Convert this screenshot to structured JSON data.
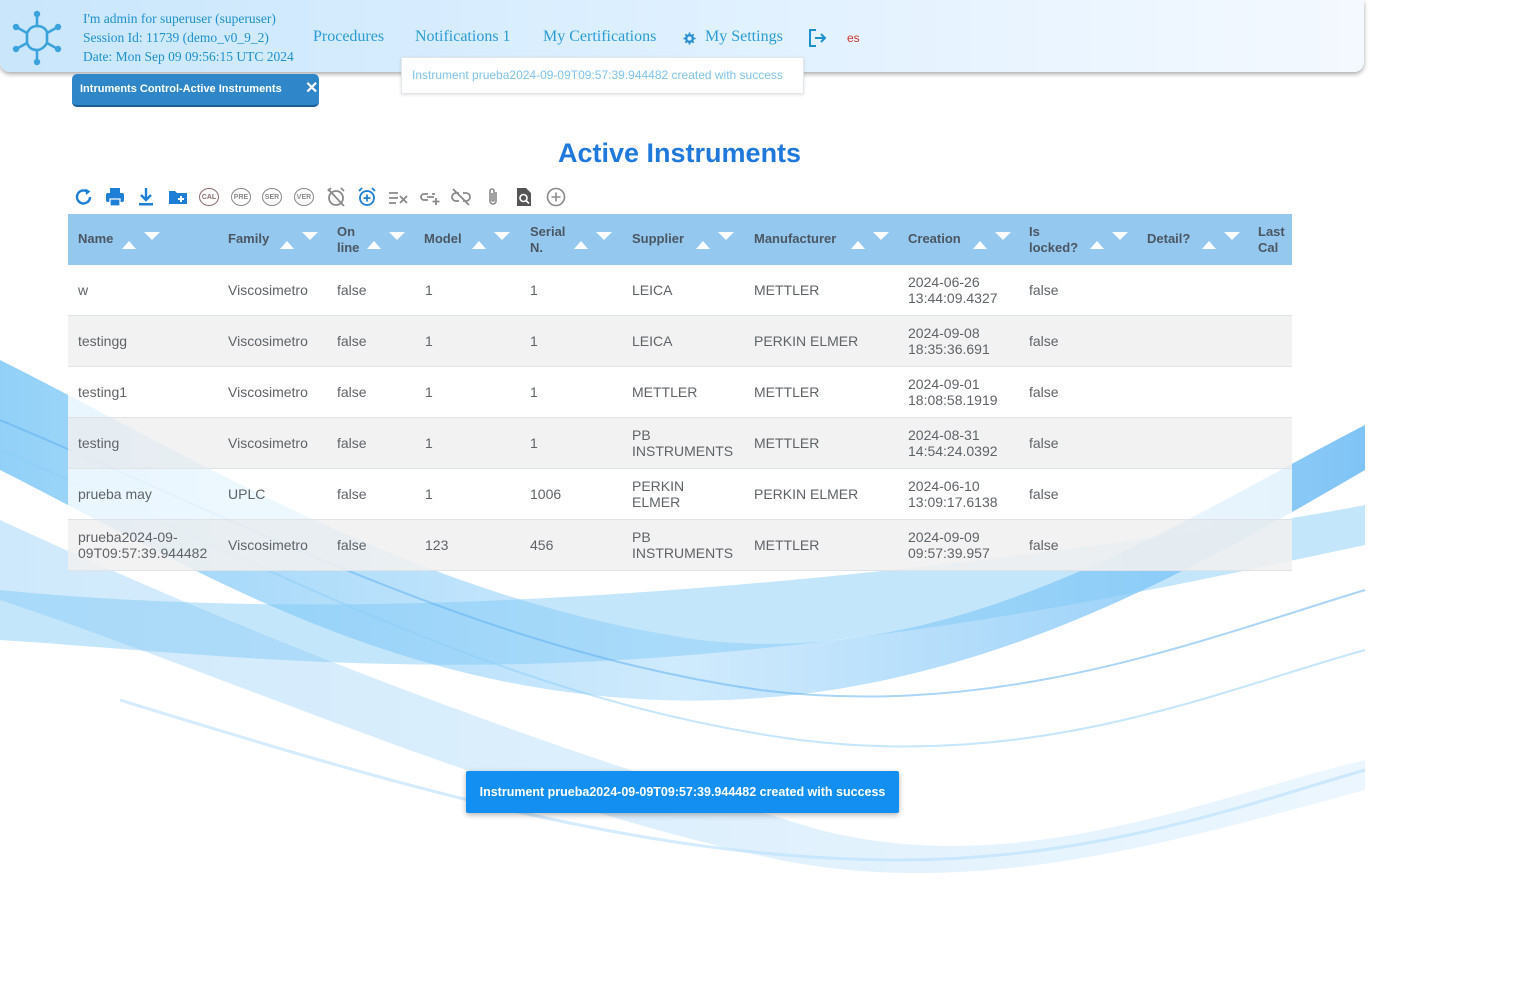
{
  "header": {
    "user_line": "I'm admin for superuser (superuser)",
    "session_line": "Session Id: 11739 (demo_v0_9_2)",
    "date_line": "Date: Mon Sep 09 09:56:15 UTC 2024",
    "nav": {
      "procedures": "Procedures",
      "notifications": "Notifications 1",
      "certifications": "My Certifications",
      "settings": "My Settings"
    },
    "logout_icon": "logout-icon",
    "language": "es"
  },
  "notification_dropdown": {
    "message": "Instrument prueba2024-09-09T09:57:39.944482 created with success"
  },
  "tab": {
    "label": "Intruments Control-Active Instruments",
    "close": "✕"
  },
  "page_title": "Active Instruments",
  "toolbar": {
    "icons": [
      "refresh-icon",
      "print-icon",
      "download-icon",
      "add-folder-icon",
      "cal-icon",
      "pre-icon",
      "ser-icon",
      "ver-icon",
      "alarm-off-icon",
      "alarm-add-icon",
      "list-remove-icon",
      "add-link-icon",
      "unlink-icon",
      "attachment-icon",
      "search-document-icon",
      "add-circle-icon"
    ],
    "text_icons": {
      "cal": "CAL",
      "pre": "PRE",
      "ser": "SER",
      "ver": "VER"
    }
  },
  "table": {
    "columns": {
      "name": "Name",
      "family": "Family",
      "online_1": "On",
      "online_2": "line",
      "model": "Model",
      "serial_1": "Serial",
      "serial_2": "N.",
      "supplier": "Supplier",
      "manufacturer": "Manufacturer",
      "creation": "Creation",
      "locked_1": "Is",
      "locked_2": "locked?",
      "detail": "Detail?",
      "lastcal_1": "Last",
      "lastcal_2": "Cal"
    },
    "rows": [
      {
        "name_1": "w",
        "name_2": "",
        "family": "Viscosimetro",
        "online": "false",
        "model": "1",
        "serial": "1",
        "supplier_1": "LEICA",
        "supplier_2": "",
        "manufacturer": "METTLER",
        "creation_1": "2024-06-26",
        "creation_2": "13:44:09.4327",
        "locked": "false",
        "detail": "",
        "lastcal": ""
      },
      {
        "name_1": "testingg",
        "name_2": "",
        "family": "Viscosimetro",
        "online": "false",
        "model": "1",
        "serial": "1",
        "supplier_1": "LEICA",
        "supplier_2": "",
        "manufacturer": "PERKIN ELMER",
        "creation_1": "2024-09-08",
        "creation_2": "18:35:36.691",
        "locked": "false",
        "detail": "",
        "lastcal": ""
      },
      {
        "name_1": "testing1",
        "name_2": "",
        "family": "Viscosimetro",
        "online": "false",
        "model": "1",
        "serial": "1",
        "supplier_1": "METTLER",
        "supplier_2": "",
        "manufacturer": "METTLER",
        "creation_1": "2024-09-01",
        "creation_2": "18:08:58.1919",
        "locked": "false",
        "detail": "",
        "lastcal": ""
      },
      {
        "name_1": "testing",
        "name_2": "",
        "family": "Viscosimetro",
        "online": "false",
        "model": "1",
        "serial": "1",
        "supplier_1": "PB",
        "supplier_2": "INSTRUMENTS",
        "manufacturer": "METTLER",
        "creation_1": "2024-08-31",
        "creation_2": "14:54:24.0392",
        "locked": "false",
        "detail": "",
        "lastcal": ""
      },
      {
        "name_1": "prueba may",
        "name_2": "",
        "family": "UPLC",
        "online": "false",
        "model": "1",
        "serial": "1006",
        "supplier_1": "PERKIN",
        "supplier_2": "ELMER",
        "manufacturer": "PERKIN ELMER",
        "creation_1": "2024-06-10",
        "creation_2": "13:09:17.6138",
        "locked": "false",
        "detail": "",
        "lastcal": ""
      },
      {
        "name_1": "prueba2024-09-",
        "name_2": "09T09:57:39.944482",
        "family": "Viscosimetro",
        "online": "false",
        "model": "123",
        "serial": "456",
        "supplier_1": "PB",
        "supplier_2": "INSTRUMENTS",
        "manufacturer": "METTLER",
        "creation_1": "2024-09-09",
        "creation_2": "09:57:39.957",
        "locked": "false",
        "detail": "",
        "lastcal": ""
      }
    ]
  },
  "toast": {
    "message": "Instrument prueba2024-09-09T09:57:39.944482 created with success"
  },
  "colors": {
    "accent": "#1f78dc",
    "header_bg": "#c9e6fb",
    "table_header": "#94c8ef",
    "toast": "#138ff2",
    "tab": "#2f86c8"
  }
}
